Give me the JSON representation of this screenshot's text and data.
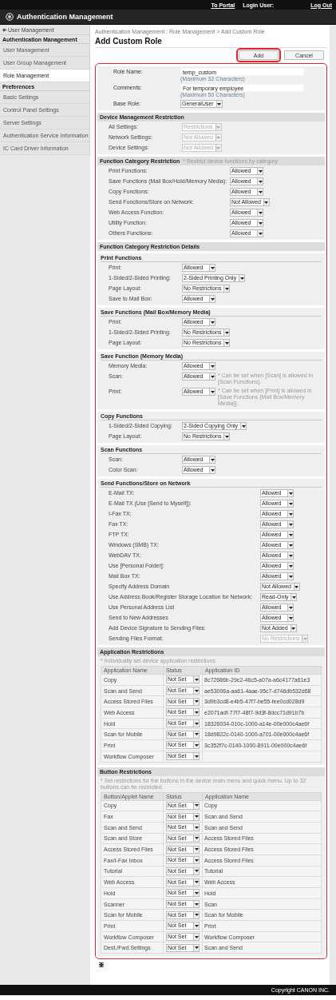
{
  "top_bar": {
    "portal_link": "To Portal",
    "login_label": "Login User:",
    "logout_link": "Log Out"
  },
  "app_title": "Authentication Management",
  "sidebar": {
    "back_link": "User Management",
    "groups": [
      {
        "heading": "Authentication Management",
        "items": [
          {
            "label": "User Management",
            "selected": false
          },
          {
            "label": "User Group Management",
            "selected": false
          },
          {
            "label": "Role Management",
            "selected": true
          }
        ]
      },
      {
        "heading": "Preferences",
        "items": [
          {
            "label": "Basic Settings",
            "selected": false
          },
          {
            "label": "Control Panel Settings",
            "selected": false
          },
          {
            "label": "Server Settings",
            "selected": false
          },
          {
            "label": "Authentication Service Information",
            "selected": false
          },
          {
            "label": "IC Card Driver Information",
            "selected": false
          }
        ]
      }
    ]
  },
  "breadcrumb": "Authentication Management : Role Management > Add Custom Role",
  "page_title": "Add Custom Role",
  "buttons": [
    {
      "label": "Add",
      "highlighted": true
    },
    {
      "label": "Cancel",
      "highlighted": false
    }
  ],
  "form": {
    "highlighted": true,
    "basic_fields": [
      {
        "kind": "text",
        "label": "Role Name:",
        "value": "temp_custom",
        "hint": "(Maximum 32 Characters)"
      },
      {
        "kind": "text",
        "label": "Comments:",
        "value": "For temporary employee",
        "hint": "(Maximum 50 Characters)"
      },
      {
        "kind": "select",
        "label": "Base Role:",
        "value": "GeneralUser"
      }
    ],
    "sections": [
      {
        "kind": "fields",
        "heading": "Device Management Restriction",
        "rows": [
          {
            "label": "All Settings:",
            "value": "Restrictions",
            "disabled": true
          },
          {
            "label": "Network Settings:",
            "value": "Not Allowed",
            "disabled": true
          },
          {
            "label": "Device Settings:",
            "value": "Not Allowed",
            "disabled": true
          }
        ]
      },
      {
        "kind": "fields",
        "heading": "Function Category Restriction",
        "note": "* Restrict device functions by category",
        "rows": [
          {
            "label": "Print Functions:",
            "value": "Allowed",
            "disabled": false
          },
          {
            "label": "Save Functions (Mail Box/Hold/Memory Media):",
            "value": "Allowed",
            "disabled": false
          },
          {
            "label": "Copy Functions:",
            "value": "Allowed",
            "disabled": false
          },
          {
            "label": "Send Functions/Store on Network:",
            "value": "Not Allowed",
            "disabled": false
          },
          {
            "label": "Web Access Function:",
            "value": "Allowed",
            "disabled": false
          },
          {
            "label": "Utility Function:",
            "value": "Allowed",
            "disabled": false
          },
          {
            "label": "Others Functions:",
            "value": "Allowed",
            "disabled": false
          }
        ]
      },
      {
        "kind": "group",
        "heading": "Function Category Restriction Details",
        "subsections": [
          {
            "heading": "Print Functions",
            "rows": [
              {
                "label": "Print:",
                "value": "Allowed",
                "disabled": false
              },
              {
                "label": "1-Sided/2-Sided Printing:",
                "value": "2-Sided Printing Only",
                "disabled": false
              },
              {
                "label": "Page Layout:",
                "value": "No Restrictions",
                "disabled": false
              },
              {
                "label": "Save to Mail Box:",
                "value": "Allowed",
                "disabled": false
              }
            ]
          },
          {
            "heading": "Save Functions (Mail Box/Memory Media)",
            "rows": [
              {
                "label": "Print:",
                "value": "Allowed",
                "disabled": false
              },
              {
                "label": "1-Sided/2-Sided Printing:",
                "value": "No Restrictions",
                "disabled": false
              },
              {
                "label": "Page Layout:",
                "value": "No Restrictions",
                "disabled": false
              }
            ]
          },
          {
            "heading": "Save Function (Memory Media)",
            "rows": [
              {
                "label": "Memory Media:",
                "value": "Allowed",
                "disabled": false
              },
              {
                "label": "Scan:",
                "value": "Allowed",
                "disabled": false,
                "note": "* Can be set when [Scan] is allowed in [Scan Functions]."
              },
              {
                "label": "Print:",
                "value": "Allowed",
                "disabled": false,
                "note": "* Can be set when [Print] is allowed in [Save Functions (Mail Box/Memory Media)]."
              }
            ]
          },
          {
            "heading": "Copy Functions",
            "rows": [
              {
                "label": "1-Sided/2-Sided Copying:",
                "value": "2-Sided Copying Only",
                "disabled": false
              },
              {
                "label": "Page Layout:",
                "value": "No Restrictions",
                "disabled": false
              }
            ]
          },
          {
            "heading": "Scan Functions",
            "rows": [
              {
                "label": "Scan:",
                "value": "Allowed",
                "disabled": false
              },
              {
                "label": "Color Scan:",
                "value": "Allowed",
                "disabled": false
              }
            ]
          },
          {
            "heading": "Send Functions/Store on Network",
            "rows": [
              {
                "label": "E-Mail TX:",
                "value": "Allowed",
                "disabled": false
              },
              {
                "label": "E-Mail TX (Use [Send to Myself]):",
                "value": "Allowed",
                "disabled": false
              },
              {
                "label": "I-Fax TX:",
                "value": "Allowed",
                "disabled": false
              },
              {
                "label": "Fax TX:",
                "value": "Allowed",
                "disabled": false
              },
              {
                "label": "FTP TX:",
                "value": "Allowed",
                "disabled": false
              },
              {
                "label": "Windows (SMB) TX:",
                "value": "Allowed",
                "disabled": false
              },
              {
                "label": "WebDAV TX:",
                "value": "Allowed",
                "disabled": false
              },
              {
                "label": "Use [Personal Folder]:",
                "value": "Allowed",
                "disabled": false
              },
              {
                "label": "Mail Box TX:",
                "value": "Allowed",
                "disabled": false
              },
              {
                "label": "Specify Address Domain",
                "value": "Not Allowed",
                "disabled": false
              },
              {
                "label": "Use Address Book/Register Storage Location for Network:",
                "value": "Read-Only",
                "disabled": false
              },
              {
                "label": "Use Personal Address List",
                "value": "Allowed",
                "disabled": false
              },
              {
                "label": "Send to New Addresses",
                "value": "Allowed",
                "disabled": false
              },
              {
                "label": "Add Device Signature to Sending Files:",
                "value": "Not Added",
                "disabled": false
              },
              {
                "label": "Sending Files Format:",
                "value": "No Restrictions",
                "disabled": true
              }
            ]
          }
        ]
      },
      {
        "kind": "table",
        "heading": "Application Restrictions",
        "note": "* Individually set device application restrictions",
        "columns": [
          "Application Name",
          "Status",
          "Application ID"
        ],
        "rows": [
          {
            "name": "Copy",
            "status": "Not Set",
            "column_3": "8c72686b-29c2-46c5-a07a-a6c4177a61e3"
          },
          {
            "name": "Scan and Send",
            "status": "Not Set",
            "column_3": "ae53006a-aa61-4aae-95c7-d746db532d68"
          },
          {
            "name": "Access Stored Files",
            "status": "Not Set",
            "column_3": "3d9b3cd8-e4b5-47f7-be55-fee0cd028d9"
          },
          {
            "name": "Web Access",
            "status": "Not Set",
            "column_3": "e2071adf-77f7-48f7-9d3f-8dcc71d91b7b"
          },
          {
            "name": "Hold",
            "status": "Not Set",
            "column_3": "18326034-010c-1000-a14e-00e000c4ae6f"
          },
          {
            "name": "Scan for Mobile",
            "status": "Not Set",
            "column_3": "18d9822c-0140-1000-a701-00e000c4ae6f"
          },
          {
            "name": "Print",
            "status": "Not Set",
            "column_3": "3c352f7c-0140-1000-8911-00e000c4ae6f"
          },
          {
            "name": "Workflow Composer",
            "status": "Not Set"
          }
        ]
      },
      {
        "kind": "table",
        "heading": "Button Restrictions",
        "note": "* Set restrictions for the buttons in the device main menu and quick menu. Up to 32 buttons can be restricted.",
        "columns": [
          "Button/Applet Name",
          "Status",
          "Application Name"
        ],
        "rows": [
          {
            "name": "Copy",
            "status": "Not Set",
            "column_3": "Copy"
          },
          {
            "name": "Fax",
            "status": "Not Set",
            "column_3": "Scan and Send"
          },
          {
            "name": "Scan and Send",
            "status": "Not Set",
            "column_3": "Scan and Send"
          },
          {
            "name": "Scan and Store",
            "status": "Not Set",
            "column_3": "Access Stored Files"
          },
          {
            "name": "Access Stored Files",
            "status": "Not Set",
            "column_3": "Access Stored Files"
          },
          {
            "name": "Fax/I-Fax Inbox",
            "status": "Not Set",
            "column_3": "Access Stored Files"
          },
          {
            "name": "Tutorial",
            "status": "Not Set",
            "column_3": "Tutorial"
          },
          {
            "name": "Web Access",
            "status": "Not Set",
            "column_3": "Web Access"
          },
          {
            "name": "Hold",
            "status": "Not Set",
            "column_3": "Hold"
          },
          {
            "name": "Scanner",
            "status": "Not Set",
            "column_3": "Scan"
          },
          {
            "name": "Scan for Mobile",
            "status": "Not Set",
            "column_3": "Scan for Mobile"
          },
          {
            "name": "Print",
            "status": "Not Set",
            "column_3": "Print"
          },
          {
            "name": "Workflow Composer",
            "status": "Not Set",
            "column_3": "Workflow Composer"
          },
          {
            "name": "Dest./Fwd.Settings",
            "status": "Not Set",
            "column_3": "Scan and Send"
          }
        ]
      }
    ]
  },
  "footer": {
    "copyright": "Copyright CANON INC."
  }
}
